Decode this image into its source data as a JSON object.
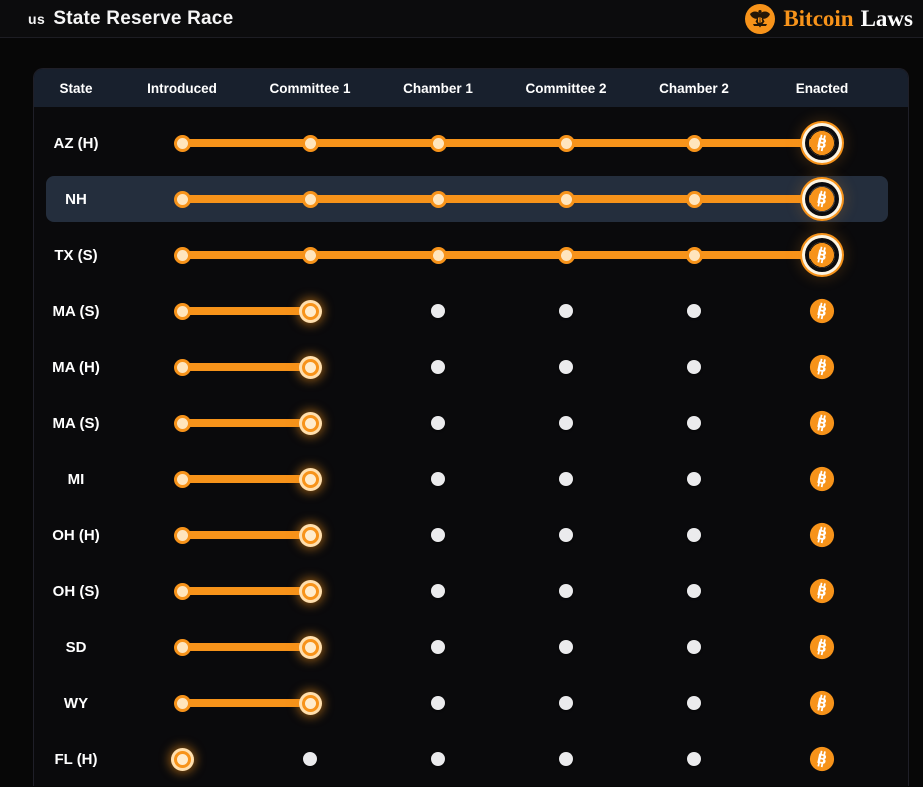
{
  "topbar": {
    "title_prefix": "us",
    "title": "State Reserve Race",
    "brand": {
      "name_orange": "Bitcoin",
      "name_white": "Laws",
      "seal_icon": "eagle-seal-icon"
    }
  },
  "colors": {
    "accent_orange": "#f7931a",
    "dot_done_fill": "#ffe5bd",
    "dot_todo_fill": "#ebebed",
    "header_row_bg": "#18202d",
    "highlight_row_bg": "#242e3d",
    "page_bg": "#070707"
  },
  "table": {
    "columns": [
      "State",
      "Introduced",
      "Committee 1",
      "Chamber 1",
      "Committee 2",
      "Chamber 2",
      "Enacted"
    ],
    "stages_per_row": 6,
    "rows": [
      {
        "state": "AZ (H)",
        "progress": 6,
        "enacted": true,
        "highlighted": false
      },
      {
        "state": "NH",
        "progress": 6,
        "enacted": true,
        "highlighted": true
      },
      {
        "state": "TX (S)",
        "progress": 6,
        "enacted": true,
        "highlighted": false
      },
      {
        "state": "MA (S)",
        "progress": 2,
        "enacted": false,
        "highlighted": false
      },
      {
        "state": "MA (H)",
        "progress": 2,
        "enacted": false,
        "highlighted": false
      },
      {
        "state": "MA (S)",
        "progress": 2,
        "enacted": false,
        "highlighted": false
      },
      {
        "state": "MI",
        "progress": 2,
        "enacted": false,
        "highlighted": false
      },
      {
        "state": "OH (H)",
        "progress": 2,
        "enacted": false,
        "highlighted": false
      },
      {
        "state": "OH (S)",
        "progress": 2,
        "enacted": false,
        "highlighted": false
      },
      {
        "state": "SD",
        "progress": 2,
        "enacted": false,
        "highlighted": false
      },
      {
        "state": "WY",
        "progress": 2,
        "enacted": false,
        "highlighted": false
      },
      {
        "state": "FL (H)",
        "progress": 1,
        "enacted": false,
        "highlighted": false
      }
    ]
  }
}
